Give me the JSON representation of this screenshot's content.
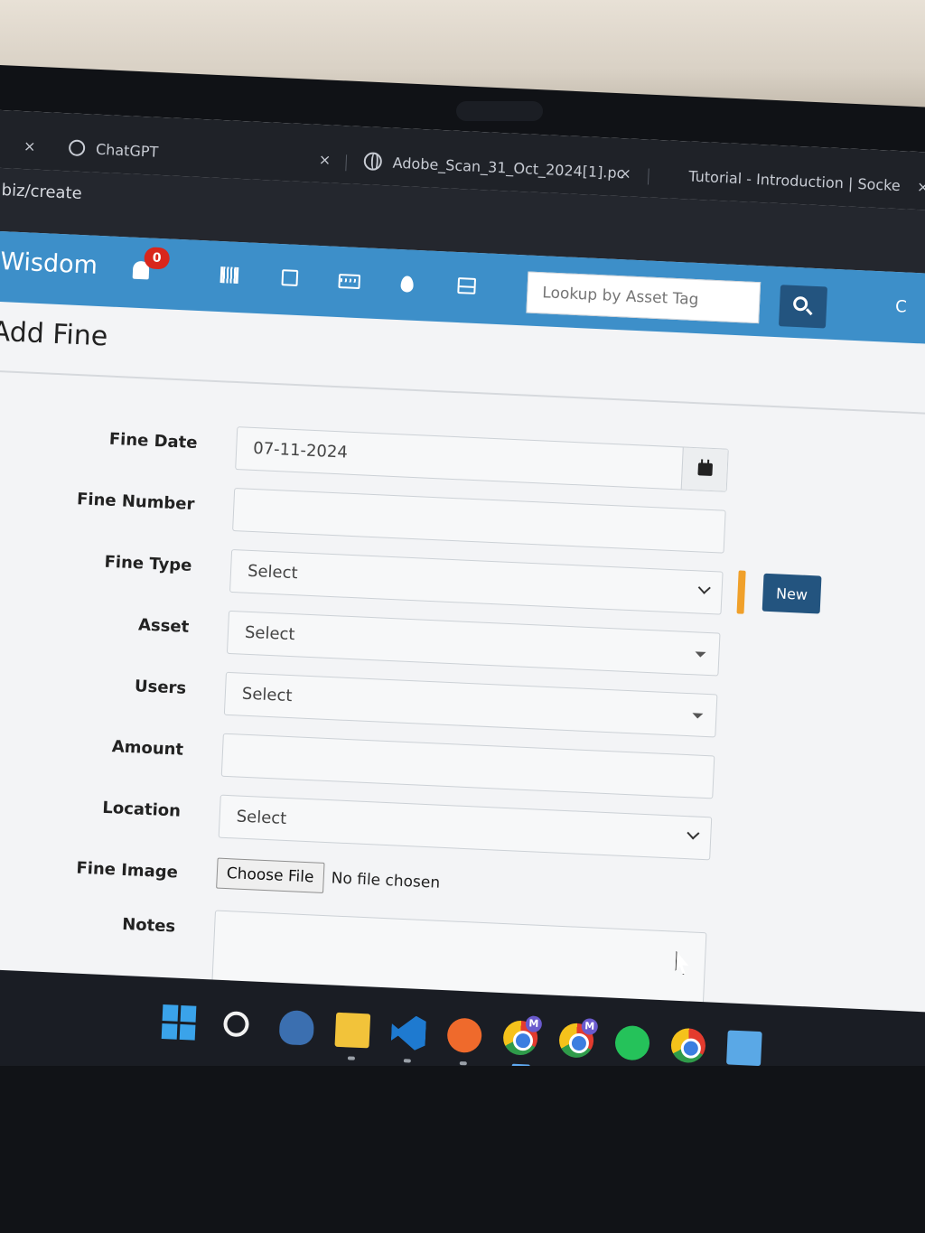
{
  "browser": {
    "tabs": [
      {
        "label": "ChatGPT"
      },
      {
        "label": "Adobe_Scan_31_Oct_2024[1].pc"
      },
      {
        "label": "Tutorial - Introduction | Socke"
      }
    ],
    "close_glyph": "×",
    "url": ".biz/create"
  },
  "navbar": {
    "brand": "Wisdom",
    "notification_count": "0",
    "lookup_placeholder": "Lookup by Asset Tag",
    "right_text": "C",
    "icons": [
      "barcode-icon",
      "save-icon",
      "keyboard-icon",
      "drop-icon",
      "hdd-icon",
      "search-icon"
    ]
  },
  "page": {
    "title": "Add Fine"
  },
  "form": {
    "fine_date": {
      "label": "Fine Date",
      "value": "07-11-2024"
    },
    "fine_number": {
      "label": "Fine Number",
      "value": ""
    },
    "fine_type": {
      "label": "Fine Type",
      "value": "Select",
      "new_button": "New"
    },
    "asset": {
      "label": "Asset",
      "value": "Select"
    },
    "users": {
      "label": "Users",
      "value": "Select"
    },
    "amount": {
      "label": "Amount",
      "value": ""
    },
    "location": {
      "label": "Location",
      "value": "Select"
    },
    "fine_image": {
      "label": "Fine Image",
      "button": "Choose File",
      "status": "No file chosen"
    },
    "notes": {
      "label": "Notes",
      "value": ""
    }
  },
  "colors": {
    "navbar": "#3d8fc9",
    "primary_button": "#23547f",
    "badge": "#d9261c",
    "accent_bar": "#f0a02a"
  },
  "taskbar": {
    "icons": [
      "windows-icon",
      "search-icon",
      "postgres-icon",
      "file-explorer-icon",
      "vscode-icon",
      "postman-icon",
      "chrome-icon",
      "chrome-icon",
      "whatsapp-icon",
      "chrome-icon",
      "notepad-icon"
    ]
  }
}
